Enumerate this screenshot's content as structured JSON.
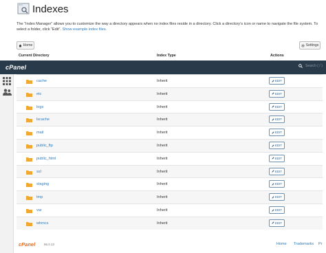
{
  "page": {
    "title": "Indexes",
    "description": "The “Index Manager” allows you to customize the way a directory appears when no index files reside in a directory. Click a directory’s icon or name to navigate the file system. To select a folder, click “Edit”.",
    "example_link": "Show example index files."
  },
  "toolbar": {
    "home_label": "Home",
    "settings_label": "Settings"
  },
  "table": {
    "headers": [
      "Current Directory",
      "Index Type",
      "Actions"
    ],
    "edit_label": "EDIT",
    "rows": [
      {
        "name": "cache",
        "type": "Inherit"
      },
      {
        "name": "etc",
        "type": "Inherit"
      },
      {
        "name": "logs",
        "type": "Inherit"
      },
      {
        "name": "lscache",
        "type": "Inherit"
      },
      {
        "name": "mail",
        "type": "Inherit"
      },
      {
        "name": "public_ftp",
        "type": "Inherit"
      },
      {
        "name": "public_html",
        "type": "Inherit"
      },
      {
        "name": "ssl",
        "type": "Inherit"
      },
      {
        "name": "staging",
        "type": "Inherit"
      },
      {
        "name": "tmp",
        "type": "Inherit"
      },
      {
        "name": "var",
        "type": "Inherit"
      },
      {
        "name": "whmcs",
        "type": "Inherit"
      }
    ]
  },
  "cpanel_bar": {
    "logo": "cPanel",
    "search_placeholder": "Search ( / )"
  },
  "footer": {
    "logo": "cPanel",
    "version": "86.0.13",
    "links": [
      "Home",
      "Trademarks",
      "Pr"
    ]
  },
  "colors": {
    "bar": "#293a4a",
    "link": "#2b7bc0",
    "folder": "#f0a830",
    "footer_logo": "#e86a1e"
  },
  "icons": {
    "page": "index-folder-icon",
    "home": "home-icon",
    "settings": "gear-icon",
    "search": "search-icon",
    "rail": [
      "grid-icon",
      "users-icon"
    ],
    "row": "folder-icon",
    "edit": "pencil-icon"
  }
}
